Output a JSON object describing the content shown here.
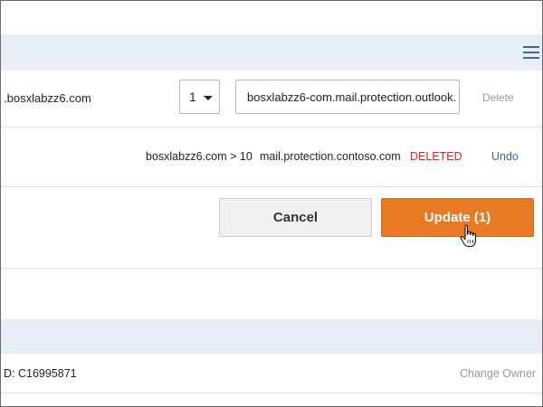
{
  "header": {
    "menu_icon": "hamburger-menu-icon"
  },
  "mx_record": {
    "domain": ".bosxlabzz6.com",
    "priority": "1",
    "points_to": "bosxlabzz6-com.mail.protection.outlook.",
    "delete_label": "Delete"
  },
  "deleted_record": {
    "source": "bosxlabzz6.com > 10",
    "target": "mail.protection.contoso.com",
    "status": "DELETED",
    "undo_label": "Undo"
  },
  "actions": {
    "cancel_label": "Cancel",
    "update_label": "Update (1)"
  },
  "footer": {
    "id_text": "D: C16995871",
    "change_owner_label": "Change Owner"
  },
  "colors": {
    "band": "#e8eef7",
    "accent": "#e97a25",
    "link": "#3a66a7",
    "deleted": "#e02020"
  }
}
